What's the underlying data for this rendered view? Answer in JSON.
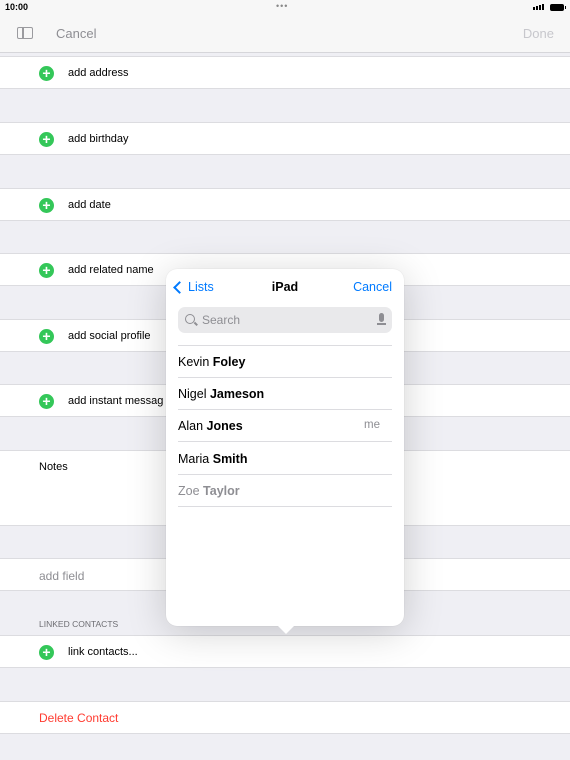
{
  "status_bar": {
    "time": "10:00",
    "dots": "•••"
  },
  "nav": {
    "cancel_label": "Cancel",
    "done_label": "Done"
  },
  "rows": {
    "add_address": "add address",
    "add_birthday": "add birthday",
    "add_date": "add date",
    "add_related_name": "add related name",
    "add_social_profile": "add social profile",
    "add_instant_message": "add instant messag",
    "notes": "Notes",
    "add_field": "add field",
    "linked_contacts_header": "LINKED CONTACTS",
    "link_contacts": "link contacts...",
    "delete_contact": "Delete Contact"
  },
  "popover": {
    "back_label": "Lists",
    "title": "iPad",
    "cancel_label": "Cancel",
    "search_placeholder": "Search",
    "contacts": [
      {
        "first": "Kevin",
        "last": "Foley",
        "tag": ""
      },
      {
        "first": "Nigel",
        "last": "Jameson",
        "tag": ""
      },
      {
        "first": "Alan",
        "last": "Jones",
        "tag": "me"
      },
      {
        "first": "Maria ",
        "last": "Smith",
        "tag": ""
      },
      {
        "first": "Zoe",
        "last": "Taylor",
        "tag": ""
      }
    ]
  },
  "colors": {
    "accent": "#007aff",
    "add_green": "#34c759",
    "delete_red": "#ff3b30",
    "background": "#efeff4"
  },
  "icons": [
    "sidebar-icon",
    "add-icon",
    "chevron-left-icon",
    "search-icon",
    "microphone-icon"
  ]
}
